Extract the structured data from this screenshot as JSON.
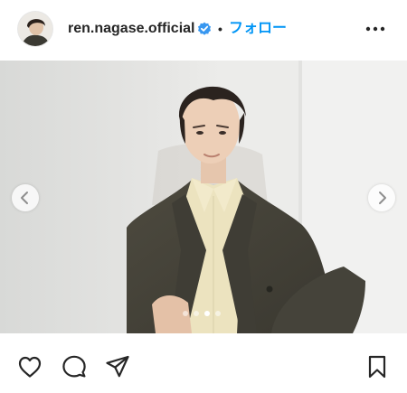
{
  "post": {
    "username": "ren.nagase.official",
    "verified": true,
    "separator": "•",
    "follow_label": "フォロー",
    "more_icon": "more-horizontal-icon"
  },
  "carousel": {
    "slide_count": 4,
    "active_slide": 2,
    "prev_icon": "chevron-left-icon",
    "next_icon": "chevron-right-icon"
  },
  "actions": {
    "like_icon": "heart-icon",
    "comment_icon": "comment-icon",
    "share_icon": "paper-plane-icon",
    "save_icon": "bookmark-icon"
  },
  "colors": {
    "link": "#0095f6",
    "verified_badge": "#3897f0",
    "text": "#262626",
    "icon": "#262626"
  }
}
